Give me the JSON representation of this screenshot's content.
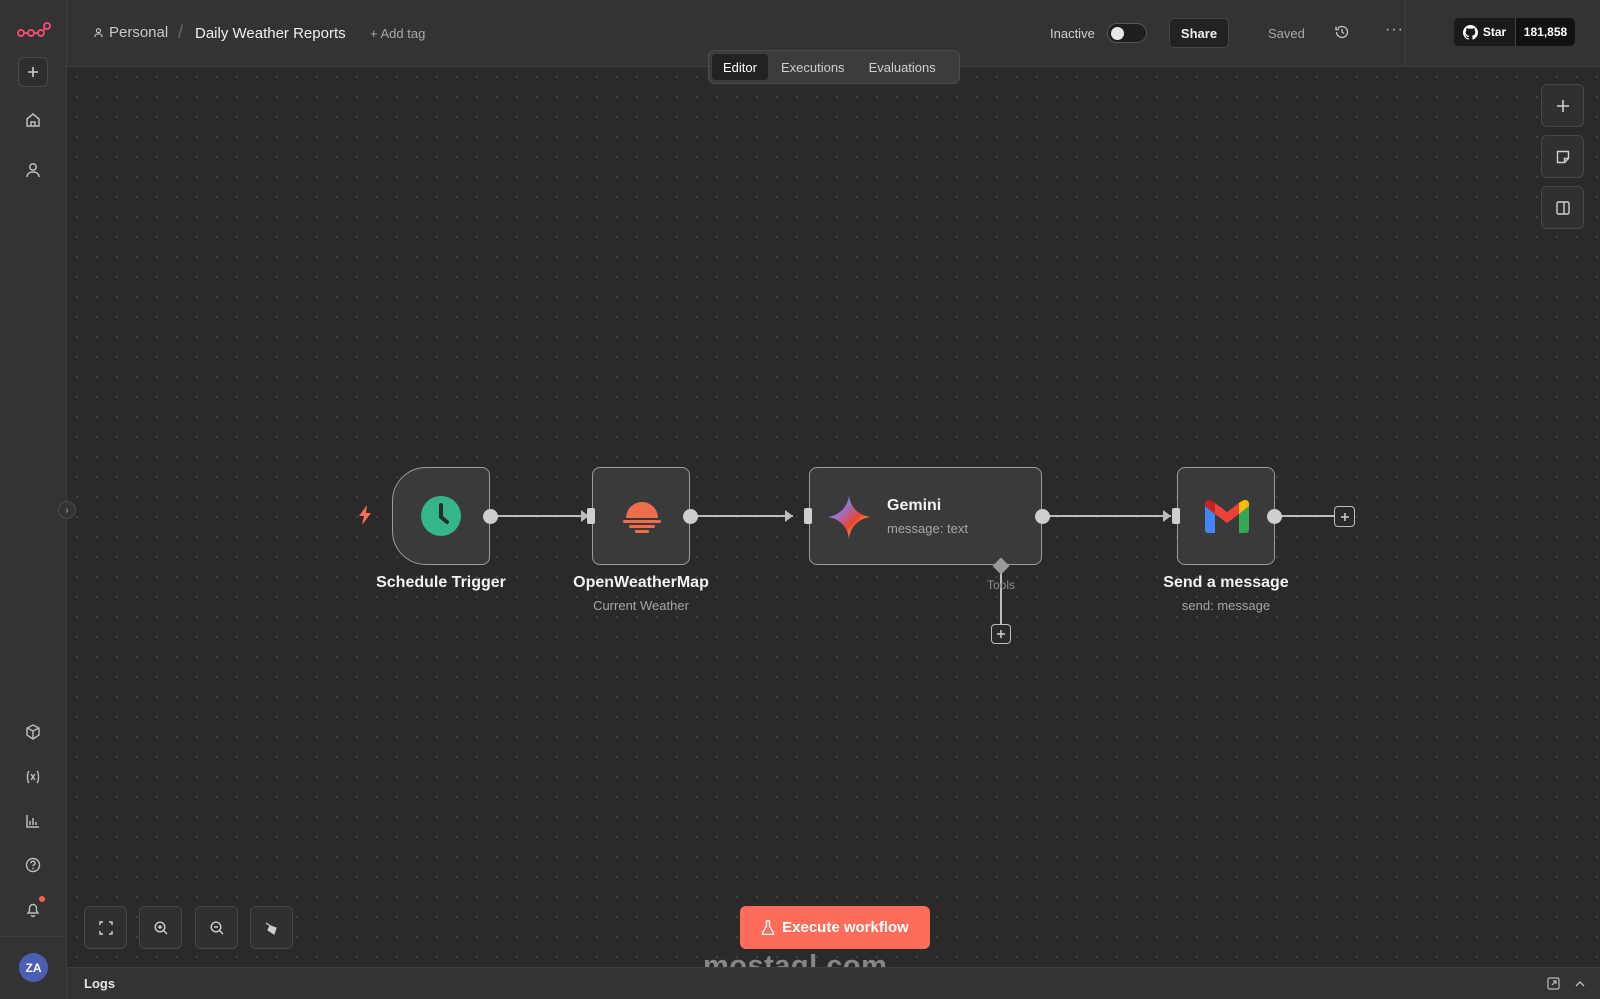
{
  "header": {
    "project": "Personal",
    "workflow_title": "Daily Weather Reports",
    "add_tag": "+ Add tag",
    "status_label": "Inactive",
    "share_label": "Share",
    "saved_label": "Saved",
    "github_star_label": "Star",
    "github_star_count": "181,858"
  },
  "tabs": [
    {
      "label": "Editor",
      "active": true
    },
    {
      "label": "Executions",
      "active": false
    },
    {
      "label": "Evaluations",
      "active": false
    }
  ],
  "nodes": {
    "schedule": {
      "label": "Schedule Trigger",
      "icon": "clock-icon"
    },
    "weather": {
      "label": "OpenWeatherMap",
      "subtitle": "Current Weather",
      "icon": "sunset-icon"
    },
    "gemini": {
      "label": "Gemini",
      "subtitle": "message: text",
      "tools_label": "Tools",
      "icon": "gemini-star-icon"
    },
    "gmail": {
      "label": "Send a message",
      "subtitle": "send: message",
      "icon": "gmail-icon"
    }
  },
  "canvas": {
    "execute_label": "Execute workflow"
  },
  "sidebar": {
    "avatar_initials": "ZA"
  },
  "logs": {
    "label": "Logs"
  },
  "watermark": "mostaql.com",
  "colors": {
    "accent": "#ff6c5c",
    "trigger_green": "#35b58c",
    "weather_orange": "#ee6e4b",
    "background": "#2a2a2a",
    "panel": "#333333"
  }
}
